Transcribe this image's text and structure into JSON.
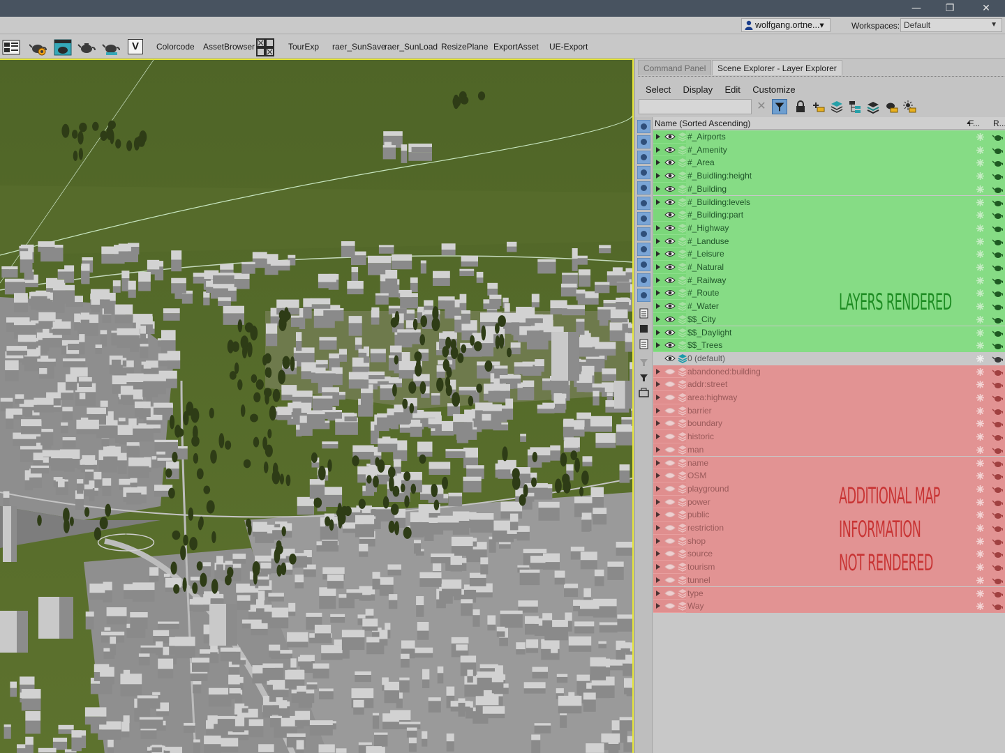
{
  "window": {
    "minimize": "—",
    "restore": "❐",
    "close": "✕"
  },
  "account": {
    "user": "wolfgang.ortne...",
    "dropdown_arrow": "▾",
    "workspaces_label": "Workspaces:",
    "workspace": "Default"
  },
  "toolbar": {
    "icons": [
      "viewport-layout-icon",
      "teapot-gear-icon",
      "render-setup-icon",
      "teapot-render-icon",
      "teapot-active-icon",
      "gradient-v-icon",
      "grid-icon"
    ],
    "v_glyph": "V",
    "buttons": [
      "Colorcode",
      "AssetBrowser",
      "TourExp",
      "raer_SunSave",
      "raer_SunLoad",
      "ResizePlane",
      "ExportAsset",
      "UE-Export"
    ]
  },
  "panel": {
    "tabs": [
      "Command Panel",
      "Scene Explorer - Layer Explorer"
    ],
    "menu": [
      "Select",
      "Display",
      "Edit",
      "Customize"
    ],
    "search_value": "",
    "clear": "✕",
    "header": {
      "name": "Name (Sorted Ascending)",
      "sort_arrow": "▲",
      "f": "F...",
      "r": "R..."
    }
  },
  "layers_rendered": [
    "#_Airports",
    "#_Amenity",
    "#_Area",
    "#_Buidling:height",
    "#_Building",
    "#_Building:levels",
    "#_Building:part",
    "#_Highway",
    "#_Landuse",
    "#_Leisure",
    "#_Natural",
    "#_Railway",
    "#_Route",
    "#_Water",
    "$$_City",
    "$$_Daylight",
    "$$_Trees"
  ],
  "default_layer": "0 (default)",
  "layers_not_rendered": [
    "abandoned:building",
    "addr:street",
    "area:highway",
    "barrier",
    "boundary",
    "historic",
    "man",
    "name",
    "OSM",
    "playground",
    "power",
    "public",
    "restriction",
    "shop",
    "source",
    "tourism",
    "tunnel",
    "type",
    "Way"
  ],
  "annotations": {
    "green": "LAYERS RENDERED",
    "red": [
      "ADDITIONAL MAP",
      "INFORMATION",
      "NOT RENDERED"
    ]
  },
  "colors": {
    "rendered": "#7bd77a",
    "not_rendered": "#e08e8e",
    "viewport_border": "#e2e236",
    "terrain": "#5a6e2e"
  }
}
